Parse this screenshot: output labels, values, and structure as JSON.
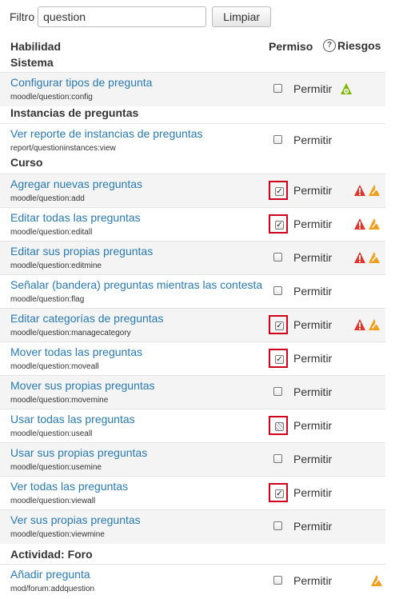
{
  "filter": {
    "label": "Filtro",
    "value": "question",
    "clear_label": "Limpiar"
  },
  "header": {
    "skill": "Habilidad",
    "permission": "Permiso",
    "help": "?",
    "risks": "Riesgos"
  },
  "sections": [
    {
      "title": "Sistema",
      "rows": [
        {
          "name": "Configurar tipos de pregunta",
          "id": "moodle/question:config",
          "checked": false,
          "partial": false,
          "highlight": false,
          "perm": "Permitir",
          "risks": [
            "config-icon"
          ]
        }
      ]
    },
    {
      "title": "Instancias de preguntas",
      "rows": [
        {
          "name": "Ver reporte de instancias de preguntas",
          "id": "report/questioninstances:view",
          "checked": false,
          "partial": false,
          "highlight": false,
          "perm": "Permitir",
          "risks": []
        }
      ]
    },
    {
      "title": "Curso",
      "rows": [
        {
          "name": "Agregar nuevas preguntas",
          "id": "moodle/question:add",
          "checked": true,
          "partial": false,
          "highlight": true,
          "perm": "Permitir",
          "risks": [
            "xss-risk-icon",
            "spam-risk-icon"
          ]
        },
        {
          "name": "Editar todas las preguntas",
          "id": "moodle/question:editall",
          "checked": true,
          "partial": false,
          "highlight": true,
          "perm": "Permitir",
          "risks": [
            "xss-risk-icon",
            "spam-risk-icon"
          ]
        },
        {
          "name": "Editar sus propias preguntas",
          "id": "moodle/question:editmine",
          "checked": false,
          "partial": false,
          "highlight": false,
          "perm": "Permitir",
          "risks": [
            "xss-risk-icon",
            "spam-risk-icon"
          ]
        },
        {
          "name": "Señalar (bandera) preguntas mientras las contesta",
          "id": "moodle/question:flag",
          "checked": false,
          "partial": false,
          "highlight": false,
          "perm": "Permitir",
          "risks": []
        },
        {
          "name": "Editar categorías de preguntas",
          "id": "moodle/question:managecategory",
          "checked": true,
          "partial": false,
          "highlight": true,
          "perm": "Permitir",
          "risks": [
            "xss-risk-icon",
            "spam-risk-icon"
          ]
        },
        {
          "name": "Mover todas las preguntas",
          "id": "moodle/question:moveall",
          "checked": true,
          "partial": false,
          "highlight": true,
          "perm": "Permitir",
          "risks": []
        },
        {
          "name": "Mover sus propias preguntas",
          "id": "moodle/question:movemine",
          "checked": false,
          "partial": false,
          "highlight": false,
          "perm": "Permitir",
          "risks": []
        },
        {
          "name": "Usar todas las preguntas",
          "id": "moodle/question:useall",
          "checked": false,
          "partial": true,
          "highlight": true,
          "perm": "Permitir",
          "risks": []
        },
        {
          "name": "Usar sus propias preguntas",
          "id": "moodle/question:usemine",
          "checked": false,
          "partial": false,
          "highlight": false,
          "perm": "Permitir",
          "risks": []
        },
        {
          "name": "Ver todas las preguntas",
          "id": "moodle/question:viewall",
          "checked": true,
          "partial": false,
          "highlight": true,
          "perm": "Permitir",
          "risks": []
        },
        {
          "name": "Ver sus propias preguntas",
          "id": "moodle/question:viewmine",
          "checked": false,
          "partial": false,
          "highlight": false,
          "perm": "Permitir",
          "risks": []
        }
      ]
    },
    {
      "title": "Actividad: Foro",
      "rows": [
        {
          "name": "Añadir pregunta",
          "id": "mod/forum:addquestion",
          "checked": false,
          "partial": false,
          "highlight": false,
          "perm": "Permitir",
          "risks": [
            "spam-risk-icon"
          ]
        }
      ]
    }
  ],
  "colors": {
    "link": "#2a7ab0",
    "highlight": "#d0021b",
    "xss": "#e0352b",
    "spam": "#f0a020",
    "config": "#7ab800"
  }
}
